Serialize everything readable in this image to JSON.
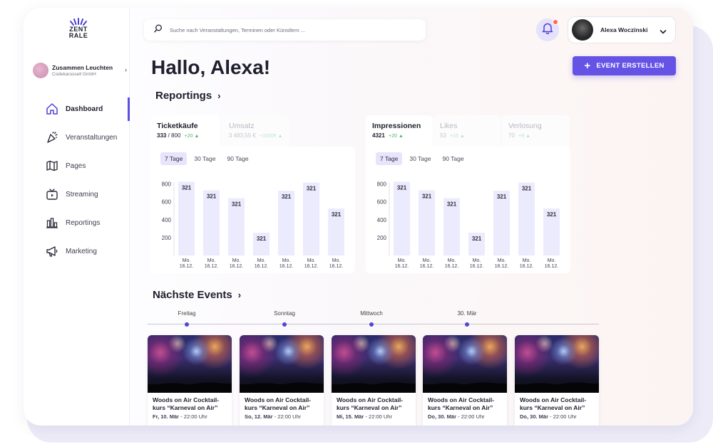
{
  "brand": {
    "logo_line1": "ZENT",
    "logo_line2": "RALE"
  },
  "organization": {
    "name": "Zusammen Leuchten",
    "subtitle": "Codekarussell GmbH"
  },
  "nav": [
    {
      "label": "Dashboard",
      "icon": "home-icon",
      "active": true
    },
    {
      "label": "Veranstaltungen",
      "icon": "party-popper-icon",
      "active": false
    },
    {
      "label": "Pages",
      "icon": "map-icon",
      "active": false
    },
    {
      "label": "Streaming",
      "icon": "streaming-tv-icon",
      "active": false
    },
    {
      "label": "Reportings",
      "icon": "bar-chart-icon",
      "active": false
    },
    {
      "label": "Marketing",
      "icon": "megaphone-icon",
      "active": false
    }
  ],
  "search": {
    "placeholder": "Suche nach Veranstaltungen, Terminen oder Künstlern ..."
  },
  "user": {
    "name": "Alexa Woczinski"
  },
  "greeting": "Hallo, Alexa!",
  "create_event_label": "EVENT ERSTELLEN",
  "reportings_title": "Reportings",
  "sales_tabs": [
    {
      "title": "Ticketkäufe",
      "value": "333",
      "total": "/ 800",
      "delta": "+20 ▲",
      "active": true
    },
    {
      "title": "Umsatz",
      "value": "3 483,55 €",
      "delta": "+1500€ ▲",
      "active": false
    }
  ],
  "reach_tabs": [
    {
      "title": "Impressionen",
      "value": "4321",
      "delta": "+20 ▲",
      "active": true
    },
    {
      "title": "Likes",
      "value": "53",
      "delta": "+15 ▲",
      "active": false
    },
    {
      "title": "Verlosung",
      "value": "70",
      "delta": "+9 ▲",
      "active": false
    }
  ],
  "range_tabs": [
    "7 Tage",
    "30 Tage",
    "90 Tage"
  ],
  "chart_data": [
    {
      "type": "bar",
      "series": [
        {
          "values": [
            825,
            730,
            640,
            255,
            725,
            815,
            525
          ]
        }
      ],
      "data_labels": [
        "321",
        "321",
        "321",
        "321",
        "321",
        "321",
        "321"
      ],
      "categories": [
        [
          "Mo.",
          "16.12."
        ],
        [
          "Mo.",
          "16.12."
        ],
        [
          "Mo.",
          "16.12."
        ],
        [
          "Mo.",
          "16.12."
        ],
        [
          "Mo.",
          "16.12."
        ],
        [
          "Mo.",
          "16.12."
        ],
        [
          "Mo.",
          "16.12."
        ]
      ],
      "y_ticks": [
        200,
        400,
        600,
        800
      ],
      "ylim": [
        0,
        900
      ],
      "color": "#eceafd"
    },
    {
      "type": "bar",
      "series": [
        {
          "values": [
            825,
            730,
            640,
            255,
            725,
            815,
            525
          ]
        }
      ],
      "data_labels": [
        "321",
        "321",
        "321",
        "321",
        "321",
        "321",
        "321"
      ],
      "categories": [
        [
          "Mo.",
          "16.12."
        ],
        [
          "Mo.",
          "16.12."
        ],
        [
          "Mo.",
          "16.12."
        ],
        [
          "Mo.",
          "16.12."
        ],
        [
          "Mo.",
          "16.12."
        ],
        [
          "Mo.",
          "16.12."
        ],
        [
          "Mo.",
          "16.12."
        ]
      ],
      "y_ticks": [
        200,
        400,
        600,
        800
      ],
      "ylim": [
        0,
        900
      ],
      "color": "#eceafd"
    }
  ],
  "next_events_title": "Nächste Events",
  "timeline": [
    "Freitag",
    "Sonntag",
    "Mittwoch",
    "30. Mär"
  ],
  "events": [
    {
      "title1": "Woods on Air Cocktail-",
      "title2": "kurs “Karneval on Air”",
      "date": "Fr, 10. Mär",
      "time": "22:00 Uhr"
    },
    {
      "title1": "Woods on Air Cocktail-",
      "title2": "kurs “Karneval on Air”",
      "date": "So, 12. Mär",
      "time": "22:00 Uhr"
    },
    {
      "title1": "Woods on Air Cocktail-",
      "title2": "kurs “Karneval on Air”",
      "date": "Mi, 15. Mär",
      "time": "22:00 Uhr"
    },
    {
      "title1": "Woods on Air Cocktail-",
      "title2": "kurs “Karneval on Air”",
      "date": "Do, 30. Mär",
      "time": "22:00 Uhr"
    },
    {
      "title1": "Woods on Air Cocktail-",
      "title2": "kurs “Karneval on Air”",
      "date": "Do, 30. Mär",
      "time": "22:00 Uhr"
    }
  ],
  "colors": {
    "accent": "#6553e6",
    "active_nav": "#5a4fe0",
    "positive": "#52b56e",
    "notification": "#ff6a4d",
    "bar": "#eceafd"
  }
}
